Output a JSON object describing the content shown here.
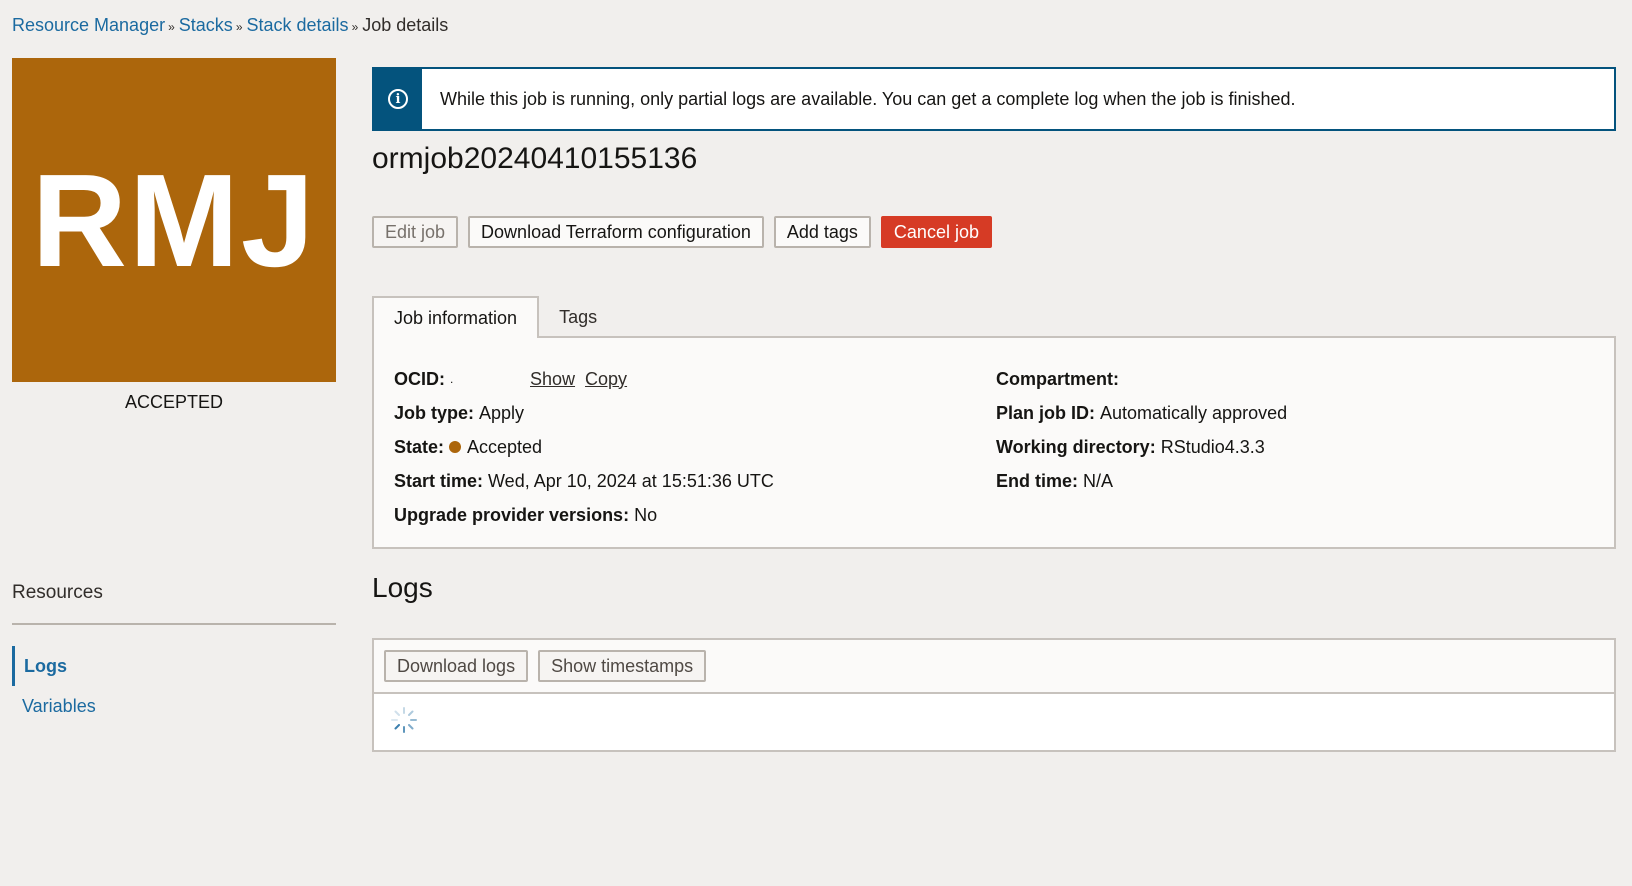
{
  "breadcrumb": {
    "items": [
      "Resource Manager",
      "Stacks",
      "Stack details"
    ],
    "current": "Job details",
    "separator": "»"
  },
  "tile": {
    "initials": "RMJ",
    "status": "ACCEPTED",
    "color": "#ac660c"
  },
  "alert": {
    "icon": "info-icon",
    "text": "While this job is running, only partial logs are available. You can get a complete log when the job is finished."
  },
  "job": {
    "title": "ormjob20240410155136"
  },
  "actions": {
    "edit": "Edit job",
    "download_config": "Download Terraform configuration",
    "add_tags": "Add tags",
    "cancel": "Cancel job"
  },
  "tabs": {
    "job_information": "Job information",
    "tags": "Tags"
  },
  "info": {
    "ocid": {
      "label": "OCID:",
      "value": ".",
      "show": "Show",
      "copy": "Copy"
    },
    "job_type": {
      "label": "Job type:",
      "value": "Apply"
    },
    "state": {
      "label": "State:",
      "value": "Accepted",
      "color": "#ac660c"
    },
    "start_time": {
      "label": "Start time:",
      "value": "Wed, Apr 10, 2024 at 15:51:36 UTC"
    },
    "upgrade": {
      "label": "Upgrade provider versions:",
      "value": "No"
    },
    "compartment": {
      "label": "Compartment:",
      "value": ""
    },
    "plan_job": {
      "label": "Plan job ID:",
      "value": "Automatically approved"
    },
    "working_dir": {
      "label": "Working directory:",
      "value": "RStudio4.3.3"
    },
    "end_time": {
      "label": "End time:",
      "value": "N/A"
    }
  },
  "resources": {
    "title": "Resources",
    "items": [
      "Logs",
      "Variables"
    ],
    "active": "Logs"
  },
  "logs": {
    "title": "Logs",
    "download": "Download logs",
    "show_timestamps": "Show timestamps",
    "loading_icon": "spinner-icon"
  }
}
